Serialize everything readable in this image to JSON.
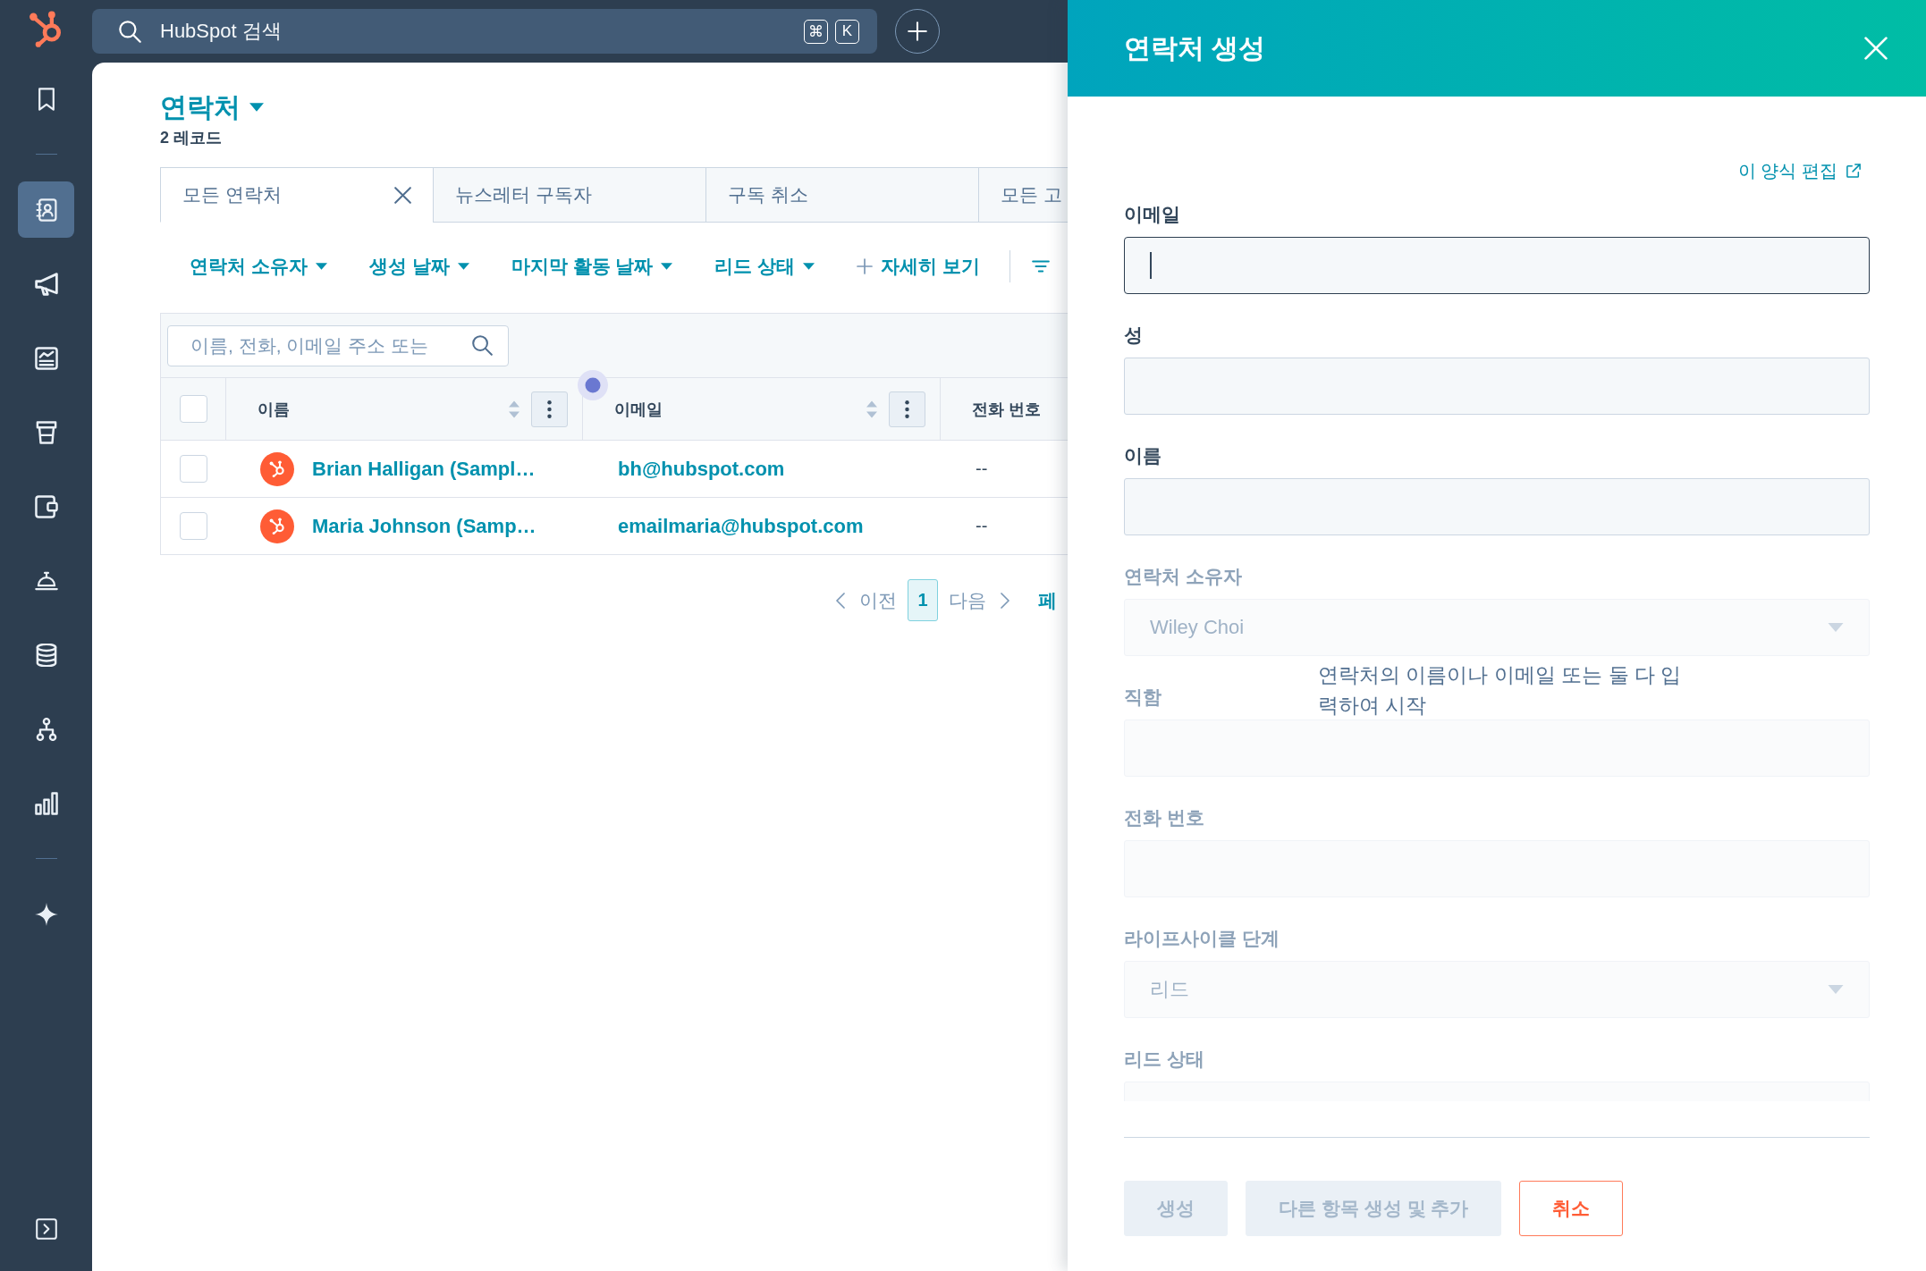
{
  "top_bar": {
    "search": {
      "placeholder": "HubSpot 검색",
      "shortcut_keys": [
        "⌘",
        "K"
      ]
    }
  },
  "sidebar": {
    "items": [
      {
        "selected": false
      },
      {
        "selected": true
      },
      {
        "selected": false
      },
      {
        "selected": false
      },
      {
        "selected": false
      },
      {
        "selected": false
      },
      {
        "selected": false
      },
      {
        "selected": false
      },
      {
        "selected": false
      },
      {
        "selected": false
      },
      {
        "selected": false
      }
    ]
  },
  "page_header": {
    "title": "연락처",
    "record_count": "2 레코드"
  },
  "view_tabs": [
    {
      "label": "모든 연락처",
      "selected": true
    },
    {
      "label": "뉴스레터 구독자",
      "selected": false
    },
    {
      "label": "구독 취소",
      "selected": false
    },
    {
      "label": "모든 고",
      "selected": false
    }
  ],
  "filters": [
    {
      "label": "연락처 소유자",
      "kind": "dropdown"
    },
    {
      "label": "생성 날짜",
      "kind": "dropdown"
    },
    {
      "label": "마지막 활동 날짜",
      "kind": "dropdown"
    },
    {
      "label": "리드 상태",
      "kind": "dropdown"
    },
    {
      "label": "자세히 보기",
      "kind": "add"
    }
  ],
  "table": {
    "search": {
      "placeholder": "이름, 전화, 이메일 주소 또는"
    },
    "select_all": {
      "checked": false
    },
    "columns": [
      {
        "label": "이름",
        "sortable": true
      },
      {
        "label": "이메일",
        "sortable": true
      },
      {
        "label": "전화 번호",
        "sortable": false
      }
    ],
    "rows": [
      {
        "checked": false,
        "name": "Brian Halligan (Sampl…",
        "email": "bh@hubspot.com",
        "phone": "--"
      },
      {
        "checked": false,
        "name": "Maria Johnson (Samp…",
        "email": "emailmaria@hubspot.com",
        "phone": "--"
      }
    ]
  },
  "pagination": {
    "previous": "이전",
    "current_page": "1",
    "next": "다음",
    "per_page_label": "페"
  },
  "create_panel": {
    "title": "연락처 생성",
    "edit_form_link": "이 양식 편집",
    "fields": [
      {
        "label": "이메일",
        "kind": "text",
        "focused": true,
        "disabled": false
      },
      {
        "label": "성",
        "kind": "text",
        "focused": false,
        "disabled": false
      },
      {
        "label": "이름",
        "kind": "text",
        "focused": false,
        "disabled": false
      },
      {
        "label": "연락처 소유자",
        "kind": "select",
        "value": "Wiley Choi",
        "focused": false,
        "disabled": true
      },
      {
        "label": "직함",
        "kind": "text",
        "focused": false,
        "disabled": true
      },
      {
        "label": "전화 번호",
        "kind": "text",
        "focused": false,
        "disabled": true
      },
      {
        "label": "라이프사이클 단계",
        "kind": "select",
        "value": "리드",
        "focused": false,
        "disabled": true
      },
      {
        "label": "리드 상태",
        "kind": "text",
        "focused": false,
        "disabled": true
      }
    ],
    "hint": "연락처의 이름이나 이메일 또는 둘 다 입력하여 시작",
    "buttons": [
      {
        "label": "생성",
        "kind": "primary",
        "disabled": true
      },
      {
        "label": "다른 항목 생성 및 추가",
        "kind": "secondary",
        "disabled": true
      },
      {
        "label": "취소",
        "kind": "cancel",
        "disabled": false
      }
    ]
  }
}
